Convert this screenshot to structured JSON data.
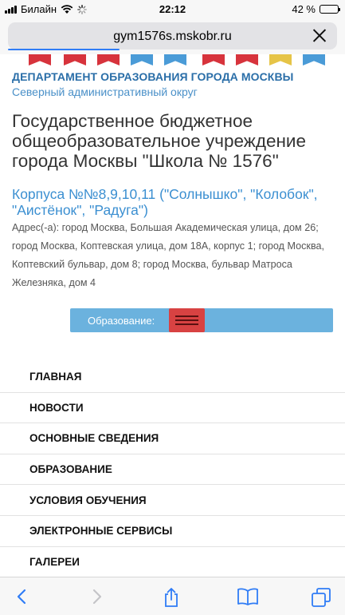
{
  "status_bar": {
    "carrier": "Билайн",
    "time": "22:12",
    "battery": "42 %",
    "battery_level": 0.42
  },
  "browser": {
    "url": "gym1576s.mskobr.ru",
    "load_progress": 0.34
  },
  "header": {
    "department": "ДЕПАРТАМЕНТ ОБРАЗОВАНИЯ ГОРОДА МОСКВЫ",
    "district": "Северный административный округ",
    "school_title": "Государственное бюджетное общеобразовательное учреждение города Москвы \"Школа № 1576\"",
    "korpusa": "Корпуса №№8,9,10,11 (\"Солнышко\", \"Колобок\", \"Аистёнок\", \"Радуга\")",
    "address": "Адрес(-а):  город Москва, Большая Академическая улица, дом 26;  город Москва, Коптевская улица, дом 18А, корпус 1;  город Москва, Коптевский бульвар, дом 8;  город Москва, бульвар Матроса Железняка, дом 4"
  },
  "education_bar": {
    "label": "Образование:"
  },
  "menu": {
    "items": [
      {
        "label": "ГЛАВНАЯ"
      },
      {
        "label": "НОВОСТИ"
      },
      {
        "label": "ОСНОВНЫЕ СВЕДЕНИЯ"
      },
      {
        "label": "ОБРАЗОВАНИЕ"
      },
      {
        "label": "УСЛОВИЯ ОБУЧЕНИЯ"
      },
      {
        "label": "ЭЛЕКТРОННЫЕ СЕРВИСЫ"
      },
      {
        "label": "ГАЛЕРЕИ"
      }
    ]
  },
  "toolbar": {
    "icons": [
      "back-icon",
      "forward-icon",
      "share-icon",
      "bookmarks-icon",
      "tabs-icon"
    ]
  },
  "colors": {
    "accent": "#3b8fd1",
    "department": "#2a6ea8",
    "edu_bar": "#6bb2de",
    "burger": "#d84242",
    "ios_blue": "#2f7cf6"
  }
}
